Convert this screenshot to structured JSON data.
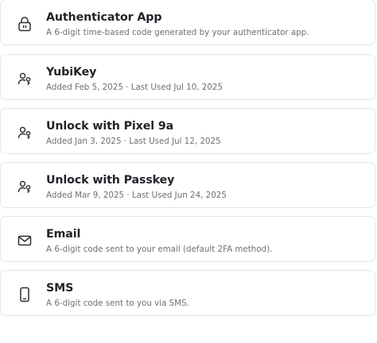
{
  "methods": [
    {
      "icon": "lock-icon",
      "title": "Authenticator App",
      "subtitle": "A 6-digit time-based code generated by your authenticator app."
    },
    {
      "icon": "user-key-icon",
      "title": "YubiKey",
      "subtitle": "Added Feb 5, 2025 · Last Used Jul 10, 2025"
    },
    {
      "icon": "user-key-icon",
      "title": "Unlock with Pixel 9a",
      "subtitle": "Added Jan 3, 2025 · Last Used Jul 12, 2025"
    },
    {
      "icon": "user-key-icon",
      "title": "Unlock with Passkey",
      "subtitle": "Added Mar 9, 2025 · Last Used Jun 24, 2025"
    },
    {
      "icon": "mail-icon",
      "title": "Email",
      "subtitle": "A 6-digit code sent to your email (default 2FA method)."
    },
    {
      "icon": "smartphone-icon",
      "title": "SMS",
      "subtitle": "A 6-digit code sent to you via SMS."
    }
  ],
  "colors": {
    "border": "#e3e5e8",
    "title": "#1f2328",
    "subtitle": "#6b6f76",
    "icon": "#2b2f36"
  }
}
